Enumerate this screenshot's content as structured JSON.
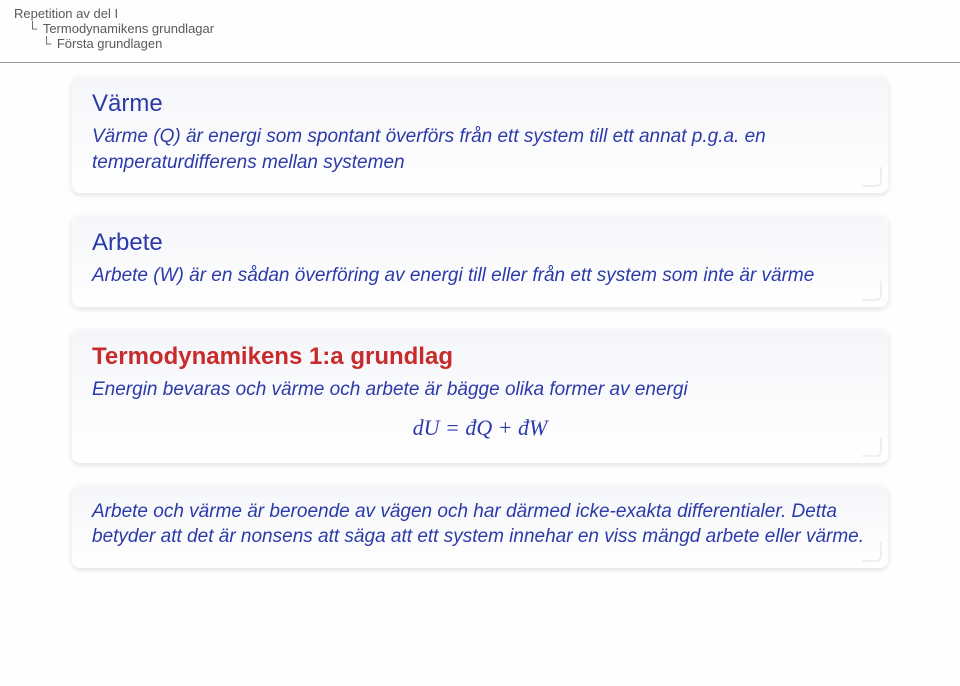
{
  "breadcrumb": {
    "line1": "Repetition av del I",
    "line2": "Termodynamikens grundlagar",
    "line3": "Första grundlagen"
  },
  "boxes": {
    "varme": {
      "title": "Värme",
      "body": "Värme (Q) är energi som spontant överförs från ett system till ett annat p.g.a. en temperaturdifferens mellan systemen"
    },
    "arbete": {
      "title": "Arbete",
      "body": "Arbete (W) är en sådan överföring av energi till eller från ett system som inte är värme"
    },
    "grundlag": {
      "title": "Termodynamikens 1:a grundlag",
      "body": "Energin bevaras och värme och arbete är bägge olika former av energi",
      "eq": "dU = đQ + đW"
    },
    "note": {
      "body": "Arbete och värme är beroende av vägen och har därmed icke-exakta differentialer. Detta betyder att det är nonsens att säga att ett system innehar en viss mängd arbete eller värme."
    }
  }
}
